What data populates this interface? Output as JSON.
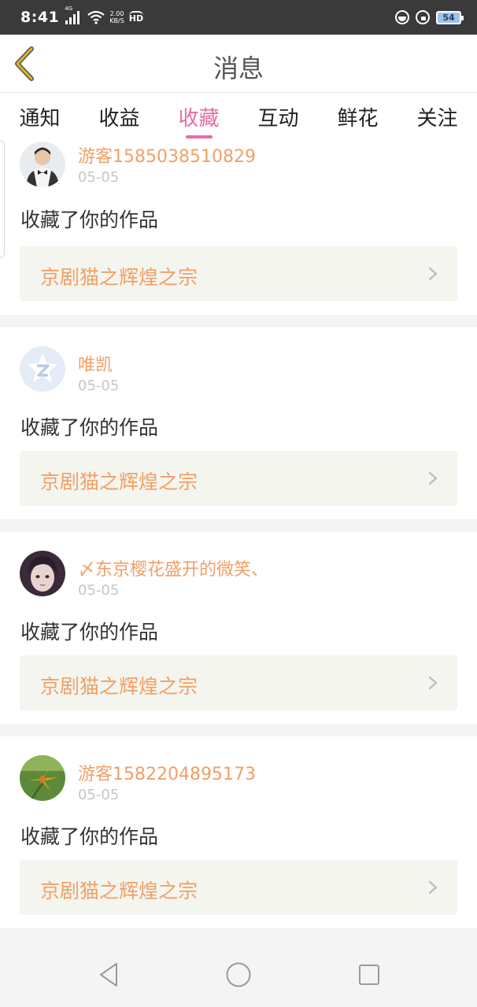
{
  "status_bar": {
    "time": "8:41",
    "network": "4G",
    "speed_value": "2.00",
    "speed_unit": "KB/S",
    "hd": "HD",
    "battery": "54"
  },
  "header": {
    "title": "消息",
    "back_icon": "chevron-left-icon",
    "accent_color": "#d8b820"
  },
  "tabs": [
    {
      "label": "通知",
      "active": false
    },
    {
      "label": "收益",
      "active": false
    },
    {
      "label": "收藏",
      "active": true
    },
    {
      "label": "互动",
      "active": false
    },
    {
      "label": "鲜花",
      "active": false
    },
    {
      "label": "关注",
      "active": false
    }
  ],
  "active_tab_color": "#ea6aa6",
  "messages": [
    {
      "username": "游客1585038510829",
      "date": "05-05",
      "action": "收藏了你的作品",
      "work_title": "京剧猫之辉煌之宗",
      "avatar": "avatar-man-icon"
    },
    {
      "username": "唯凯",
      "date": "05-05",
      "action": "收藏了你的作品",
      "work_title": "京剧猫之辉煌之宗",
      "avatar": "avatar-qzone-star-icon"
    },
    {
      "username": "〆东京樱花盛开的微笑、",
      "date": "05-05",
      "action": "收藏了你的作品",
      "work_title": "京剧猫之辉煌之宗",
      "avatar": "avatar-girl-icon"
    },
    {
      "username": "游客1582204895173",
      "date": "05-05",
      "action": "收藏了你的作品",
      "work_title": "京剧猫之辉煌之宗",
      "avatar": "avatar-flower-icon"
    }
  ],
  "username_color": "#f0a068",
  "nav": {
    "back": "triangle-back-icon",
    "home": "circle-home-icon",
    "recents": "square-recents-icon"
  }
}
